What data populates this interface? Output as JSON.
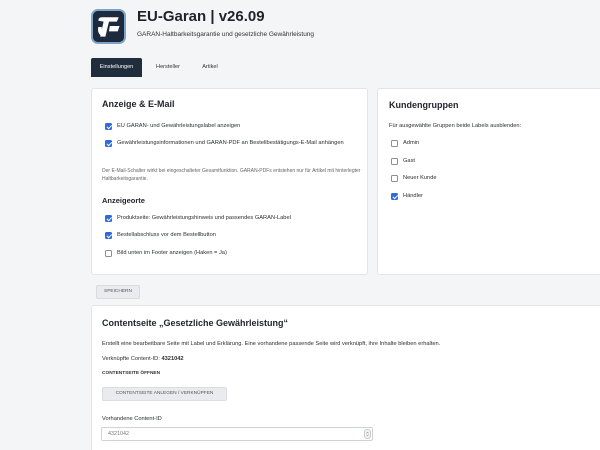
{
  "header": {
    "title": "EU-Garan | v26.09",
    "subtitle": "GARAN-Haltbarkeitsgarantie und gesetzliche Gewährleistung"
  },
  "tabs": [
    {
      "label": "Einstellungen",
      "active": true
    },
    {
      "label": "Hersteller",
      "active": false
    },
    {
      "label": "Artikel",
      "active": false
    }
  ],
  "anzeige": {
    "title": "Anzeige & E-Mail",
    "options": [
      {
        "label": "EU GARAN- und Gewährleistungslabel anzeigen",
        "checked": true
      },
      {
        "label": "Gewährleistungsinformationen und GARAN-PDF an Bestellbestätigungs-E-Mail anhängen",
        "checked": true
      }
    ],
    "note": "Der E-Mail-Schalter wirkt bei eingeschalteter Gesamtfunktion. GARAN-PDFs entstehen nur für Artikel mit hinterlegter Haltbarkeitsgarantie.",
    "orte_title": "Anzeigeorte",
    "orte": [
      {
        "label": "Produktseite: Gewährleistungshinweis und passendes GARAN-Label",
        "checked": true
      },
      {
        "label": "Bestellabschluss vor dem Bestellbutton",
        "checked": true
      },
      {
        "label": "Bild unten im Footer anzeigen (Haken = Ja)",
        "checked": false
      }
    ]
  },
  "kundengruppen": {
    "title": "Kundengruppen",
    "description": "Für ausgewählte Gruppen beide Labels ausblenden:",
    "groups": [
      {
        "label": "Admin",
        "checked": false
      },
      {
        "label": "Gast",
        "checked": false
      },
      {
        "label": "Neuer Kunde",
        "checked": false
      },
      {
        "label": "Händler",
        "checked": true
      }
    ]
  },
  "save_label": "SPEICHERN",
  "content": {
    "title": "Contentseite „Gesetzliche Gewährleistung“",
    "description": "Erstellt eine bearbeitbare Seite mit Label und Erklärung. Eine vorhandene passende Seite wird verknüpft, ihre Inhalte bleiben erhalten.",
    "linked_label": "Verknüpfte Content-ID:",
    "linked_value": "4321042",
    "open_label": "CONTENTSEITE ÖFFNEN",
    "create_button": "CONTENTSEITE ANLEGEN / VERKNÜPFEN",
    "existing_label": "Vorhandene Content-ID",
    "existing_value": "4321042"
  },
  "colors": {
    "accent": "#2f6bd7",
    "tab_active": "#1f2d3d",
    "logo_bg": "#1d2a3d"
  }
}
